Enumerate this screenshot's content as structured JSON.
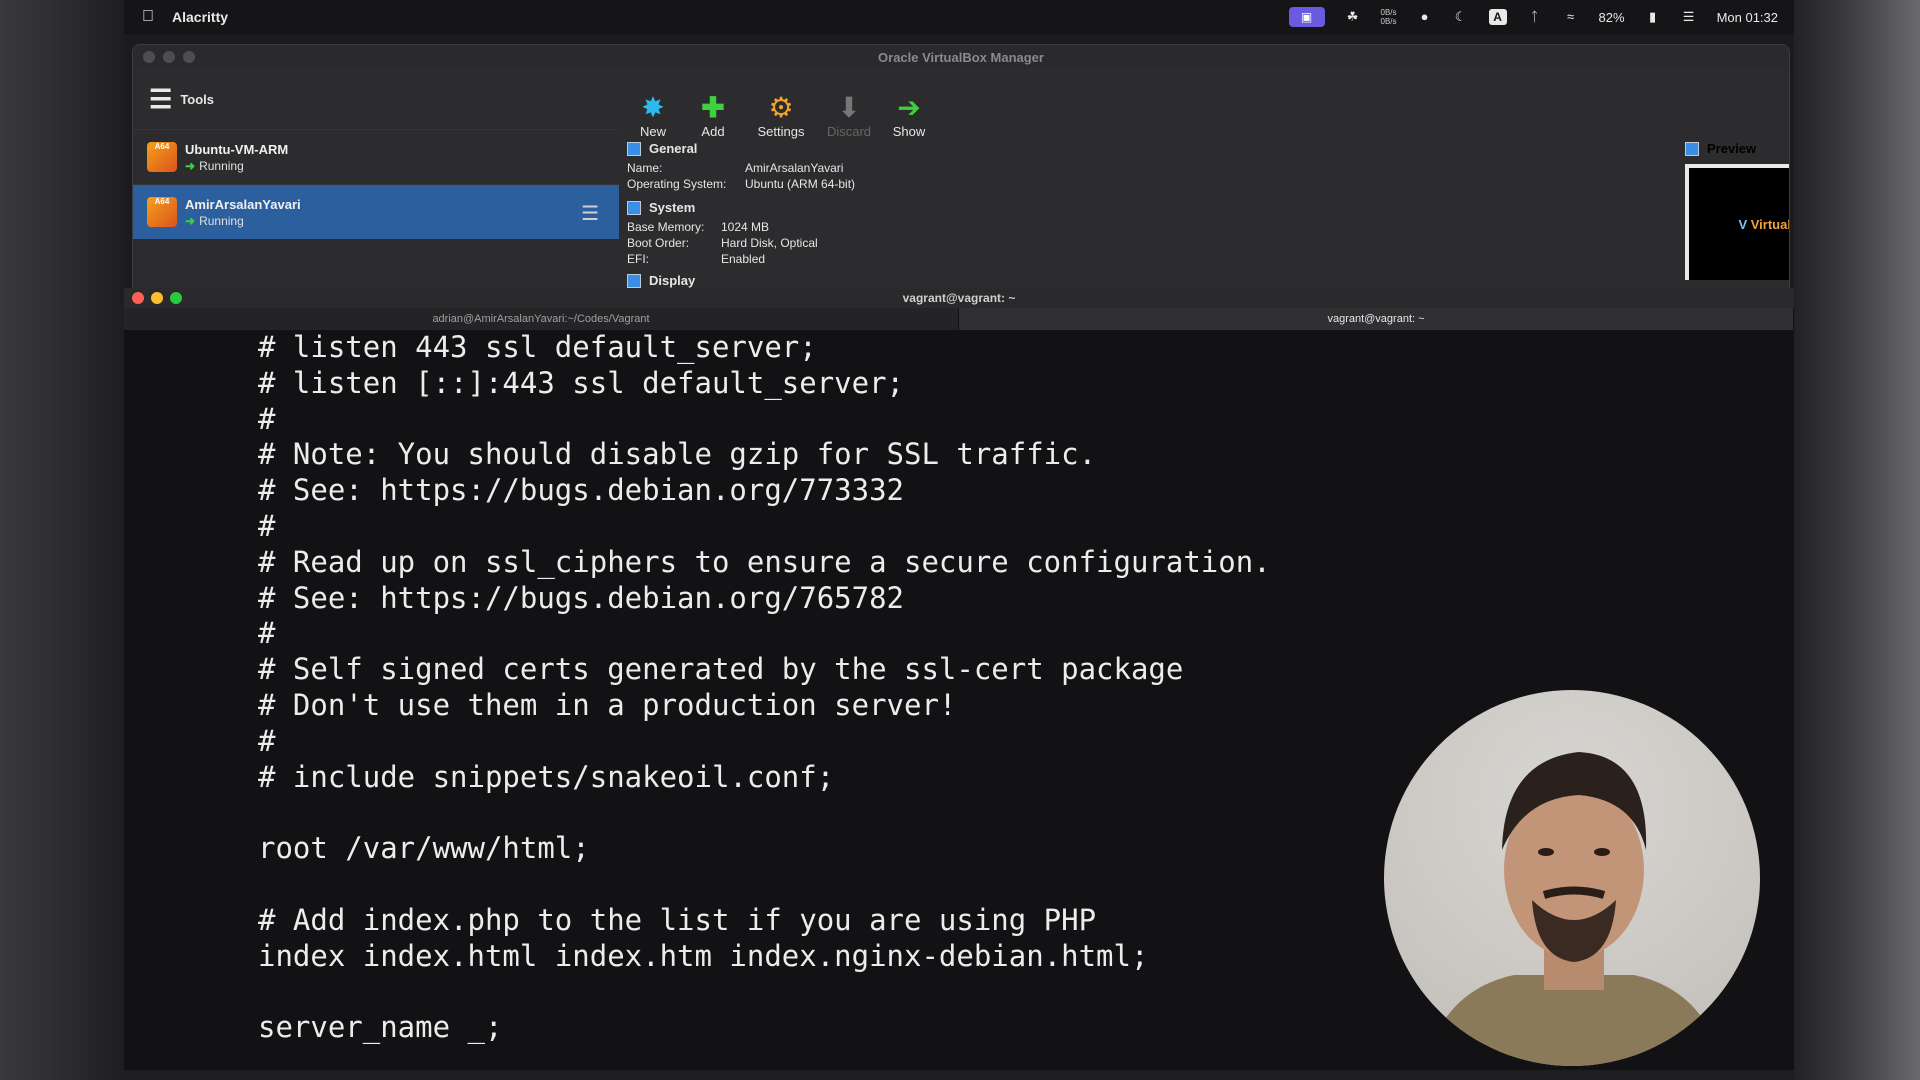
{
  "menubar": {
    "app_name": "Alacritty",
    "battery": "82%",
    "clock": "Mon 01:32",
    "net_up": "0B/s",
    "net_down": "0B/s",
    "input_source": "A",
    "icons": [
      "apple-icon",
      "screen-share-icon",
      "cat-icon",
      "network-speed-icon",
      "record-dot-icon",
      "moon-icon",
      "input-source-icon",
      "bluetooth-icon",
      "wifi-icon",
      "battery-icon",
      "control-center-icon"
    ]
  },
  "vbox": {
    "title": "Oracle VirtualBox Manager",
    "tools_label": "Tools",
    "vms": [
      {
        "name": "Ubuntu-VM-ARM",
        "state": "Running",
        "badge": "A64"
      },
      {
        "name": "AmirArsalanYavari",
        "state": "Running",
        "badge": "A64"
      }
    ],
    "toolbar": {
      "new": "New",
      "add": "Add",
      "settings": "Settings",
      "discard": "Discard",
      "show": "Show"
    },
    "general": {
      "heading": "General",
      "name_label": "Name:",
      "name_value": "AmirArsalanYavari",
      "os_label": "Operating System:",
      "os_value": "Ubuntu (ARM 64-bit)"
    },
    "system": {
      "heading": "System",
      "mem_label": "Base Memory:",
      "mem_value": "1024 MB",
      "boot_label": "Boot Order:",
      "boot_value": "Hard Disk, Optical",
      "efi_label": "EFI:",
      "efi_value": "Enabled"
    },
    "display_heading": "Display",
    "preview": {
      "heading": "Preview",
      "logo_v": "V",
      "logo_text": "VirtualBox"
    }
  },
  "terminal": {
    "title": "vagrant@vagrant: ~",
    "tabs": [
      {
        "label": "adrian@AmirArsalanYavari:~/Codes/Vagrant",
        "active": false
      },
      {
        "label": "vagrant@vagrant: ~",
        "active": true
      }
    ],
    "lines": [
      "# listen 443 ssl default_server;",
      "# listen [::]:443 ssl default_server;",
      "#",
      "# Note: You should disable gzip for SSL traffic.",
      "# See: https://bugs.debian.org/773332",
      "#",
      "# Read up on ssl_ciphers to ensure a secure configuration.",
      "# See: https://bugs.debian.org/765782",
      "#",
      "# Self signed certs generated by the ssl-cert package",
      "# Don't use them in a production server!",
      "#",
      "# include snippets/snakeoil.conf;",
      "",
      "root /var/www/html;",
      "",
      "# Add index.php to the list if you are using PHP",
      "index index.html index.htm index.nginx-debian.html;",
      "",
      "server_name _;"
    ]
  }
}
